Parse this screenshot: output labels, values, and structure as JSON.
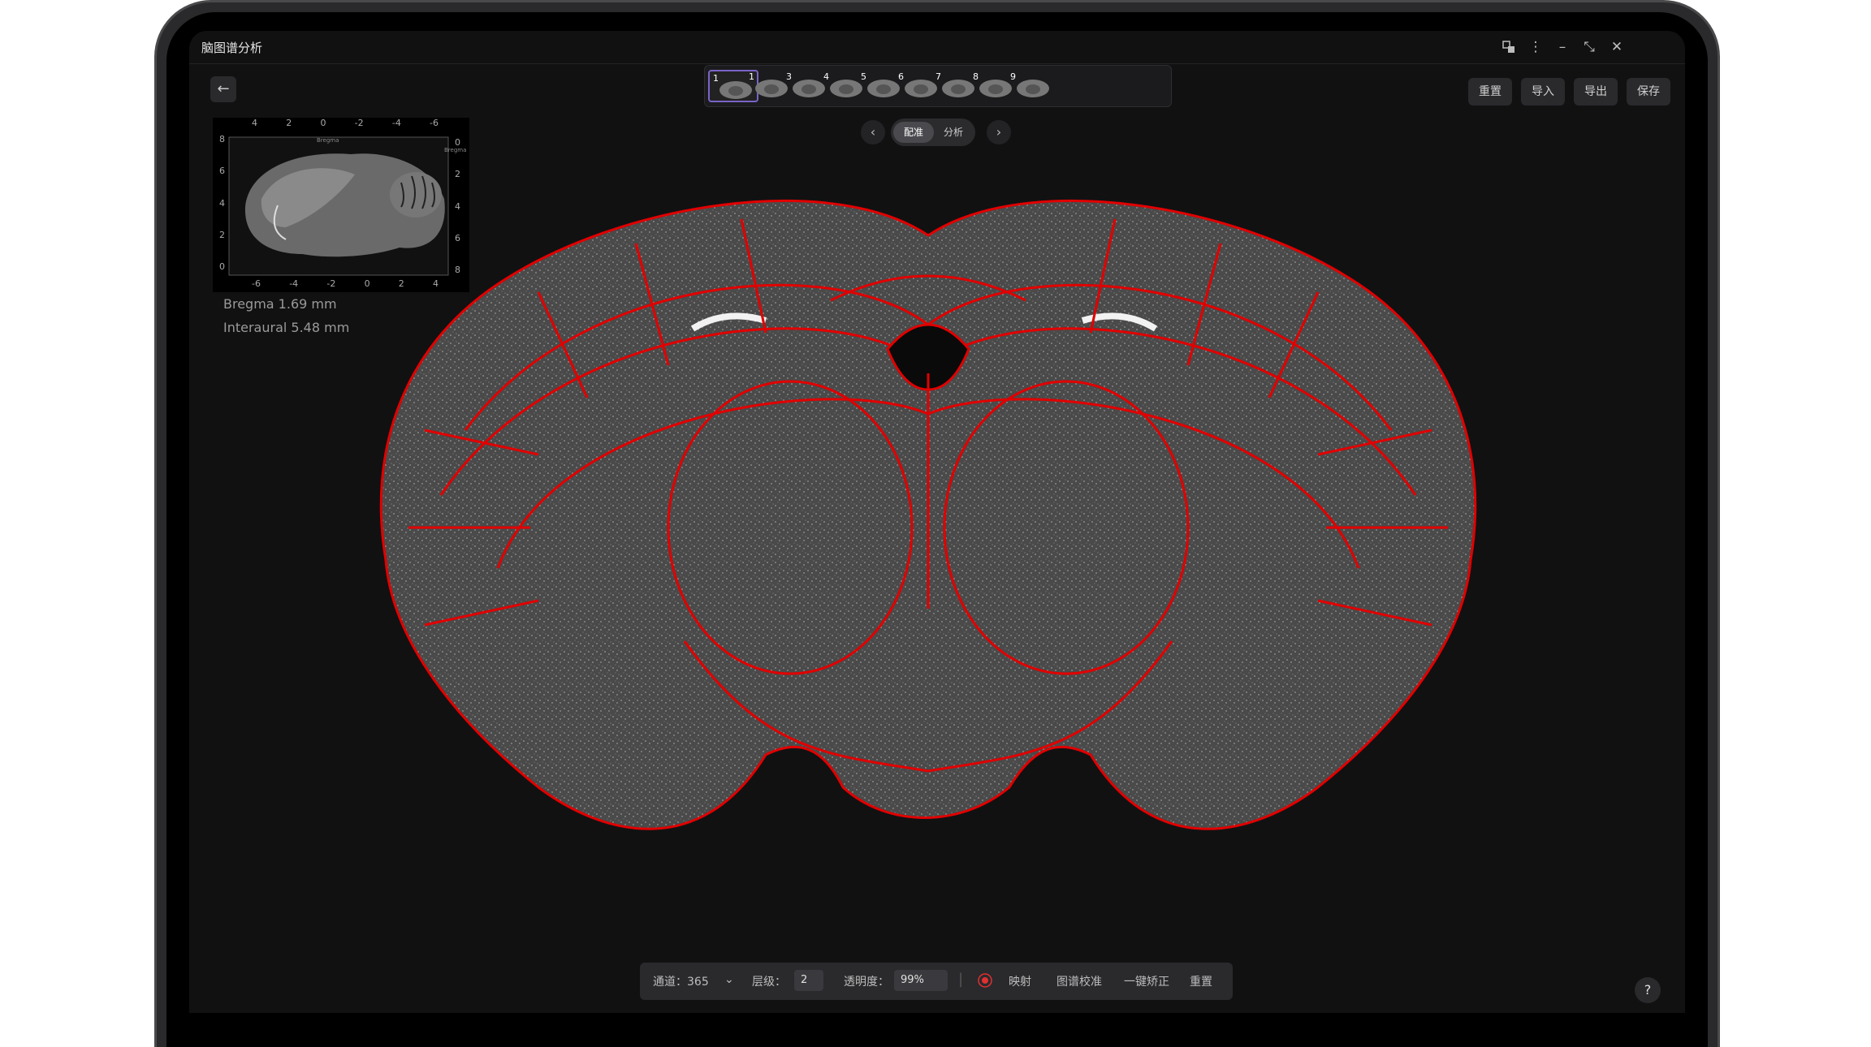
{
  "app": {
    "title": "脑图谱分析"
  },
  "toolbar": {
    "reset": "重置",
    "import": "导入",
    "export": "导出",
    "save": "保存"
  },
  "thumbnails": [
    {
      "num": "1",
      "selected": true
    },
    {
      "num": "1"
    },
    {
      "num": "3"
    },
    {
      "num": "4"
    },
    {
      "num": "5"
    },
    {
      "num": "6"
    },
    {
      "num": "7"
    },
    {
      "num": "8"
    },
    {
      "num": "9"
    }
  ],
  "modes": {
    "register": "配准",
    "analyze": "分析"
  },
  "minimap": {
    "top_ticks": [
      "4",
      "2",
      "0",
      "-2",
      "-4",
      "-6"
    ],
    "bottom_ticks": [
      "-6",
      "-4",
      "-2",
      "0",
      "2",
      "4"
    ],
    "left_ticks": [
      "8",
      "6",
      "4",
      "2",
      "0"
    ],
    "right_ticks": [
      "0",
      "2",
      "4",
      "6",
      "8"
    ],
    "label_top": "Bregma",
    "label_right": "Bregma"
  },
  "coords": {
    "bregma": "Bregma 1.69 mm",
    "interaural": "Interaural 5.48 mm"
  },
  "bottom": {
    "channel_label": "通道：365",
    "level_label": "层级：",
    "level_value": "2",
    "opacity_label": "透明度：",
    "opacity_value": "99%",
    "map": "映射",
    "calibrate": "图谱校准",
    "auto_correct": "一键矫正",
    "reset": "重置"
  },
  "help": "?",
  "colors": {
    "atlas_outline": "#e10000",
    "accent": "#7b63c8",
    "record": "#e03030"
  }
}
